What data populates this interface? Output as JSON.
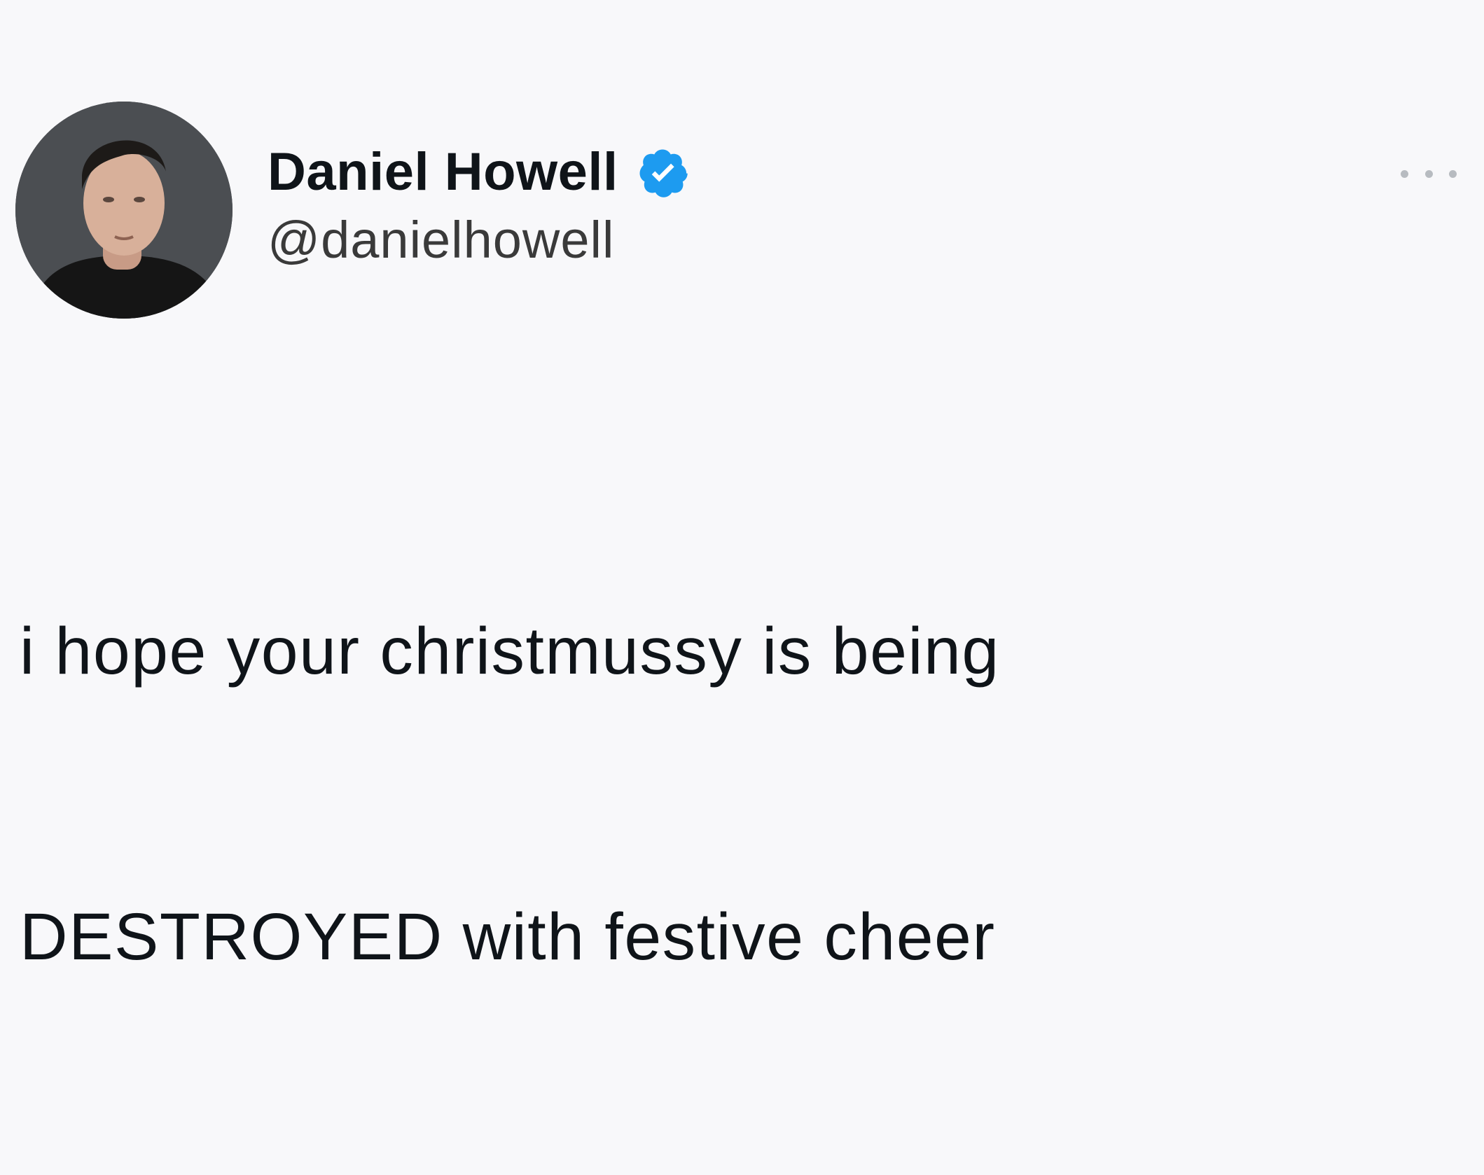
{
  "tweet": {
    "author": {
      "display_name": "Daniel Howell",
      "handle": "@danielhowell",
      "verified": true,
      "verified_color": "#1d9bf0",
      "avatar_icon": "profile-photo"
    },
    "more_icon": "more-horizontal-icon",
    "text_line_1": "i hope your christmussy is being",
    "text_line_2": "DESTROYED with festive cheer"
  }
}
